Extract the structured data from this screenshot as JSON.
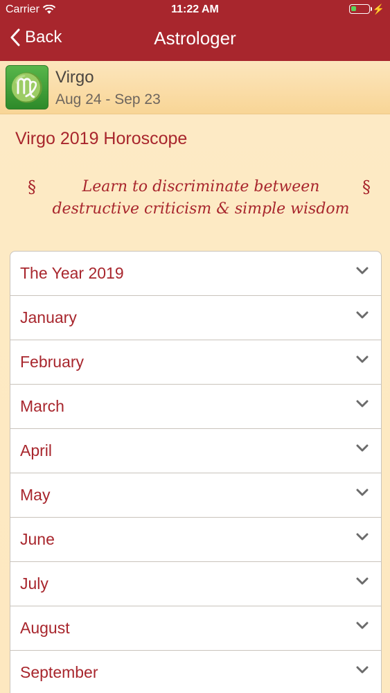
{
  "status_bar": {
    "carrier": "Carrier",
    "time": "11:22 AM",
    "battery_level": 0.3,
    "battery_color": "#5bd25b"
  },
  "nav": {
    "back_label": "Back",
    "title": "Astrologer"
  },
  "sign": {
    "symbol": "♍",
    "name": "Virgo",
    "dates": "Aug 24 - Sep 23",
    "icon_color": "#3e9b36"
  },
  "horoscope_title": "Virgo 2019 Horoscope",
  "quote": {
    "mark": "§",
    "text": "Learn to discriminate between destructive criticism & simple wisdom"
  },
  "sections": [
    "The Year 2019",
    "January",
    "February",
    "March",
    "April",
    "May",
    "June",
    "July",
    "August",
    "September"
  ],
  "colors": {
    "accent": "#a8262d",
    "background": "#fdebc6"
  }
}
